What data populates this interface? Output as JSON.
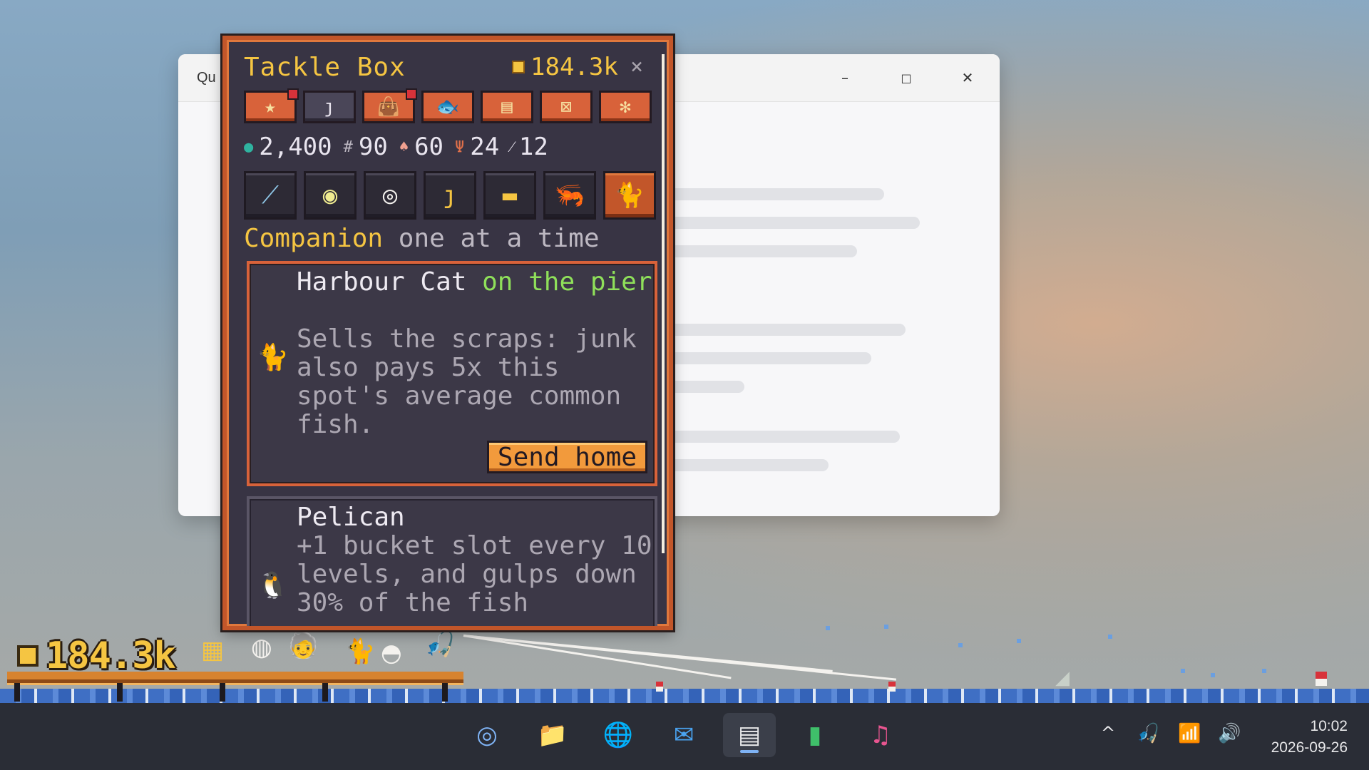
{
  "bg_window": {
    "title": "Qu",
    "minimize_glyph": "–",
    "maximize_glyph": "□",
    "close_glyph": "✕"
  },
  "tackle_box": {
    "title": "Tackle Box",
    "coins": "184.3k",
    "close_glyph": "×",
    "tabs": [
      {
        "icon": "★",
        "icon_name": "star-icon",
        "active": true,
        "notify": true
      },
      {
        "icon": "ȷ",
        "icon_name": "hook-icon",
        "active": false,
        "notify": false
      },
      {
        "icon": "👜",
        "icon_name": "bag-icon",
        "active": true,
        "notify": true
      },
      {
        "icon": "🐟",
        "icon_name": "fish-icon",
        "active": true,
        "notify": false
      },
      {
        "icon": "▤",
        "icon_name": "journal-icon",
        "active": true,
        "notify": false
      },
      {
        "icon": "⊠",
        "icon_name": "map-icon",
        "active": true,
        "notify": false
      },
      {
        "icon": "✻",
        "icon_name": "settings-icon",
        "active": true,
        "notify": false
      }
    ],
    "stats": [
      {
        "icon": "●",
        "icon_name": "gem-icon",
        "color": "#2fb3a0",
        "value": "2,400"
      },
      {
        "icon": "#",
        "icon_name": "net-icon",
        "color": "#bdb8c2",
        "value": "90"
      },
      {
        "icon": "♠",
        "icon_name": "bait-icon",
        "color": "#f0a090",
        "value": "60"
      },
      {
        "icon": "Ψ",
        "icon_name": "trophy-icon",
        "color": "#e0704a",
        "value": "24"
      },
      {
        "icon": "⁄",
        "icon_name": "rod-icon",
        "color": "#e9e5ef",
        "value": "12"
      }
    ],
    "slots": [
      {
        "icon": "⟋",
        "icon_name": "rod-slot-icon",
        "color": "#8fc7e8",
        "selected": false
      },
      {
        "icon": "◉",
        "icon_name": "bobber-slot-icon",
        "color": "#f0ec90",
        "selected": false
      },
      {
        "icon": "◎",
        "icon_name": "line-slot-icon",
        "color": "#f4f2ee",
        "selected": false
      },
      {
        "icon": "ȷ",
        "icon_name": "hook-slot-icon",
        "color": "#f5c542",
        "selected": false
      },
      {
        "icon": "▬",
        "icon_name": "hat-slot-icon",
        "color": "#f5c542",
        "selected": false
      },
      {
        "icon": "🦐",
        "icon_name": "bait-slot-icon",
        "color": "#e0704a",
        "selected": false
      },
      {
        "icon": "🐈",
        "icon_name": "companion-slot-icon",
        "color": "#e0704a",
        "selected": true
      }
    ],
    "section_title": "Companion",
    "section_sub": "one at a time",
    "companions": [
      {
        "icon": "🐈",
        "icon_name": "cat-icon",
        "name": "Harbour Cat",
        "location": "on the pier",
        "desc": "Sells the scraps: junk also pays 5x this spot's average common fish.",
        "button": "Send home"
      },
      {
        "icon": "🐧",
        "icon_name": "pelican-icon",
        "name": "Pelican",
        "desc": "+1 bucket slot every 10 levels, and gulps down 30% of the fish"
      }
    ]
  },
  "hud": {
    "coins": "184.3k"
  },
  "taskbar": {
    "apps": [
      {
        "icon": "◎",
        "icon_name": "launcher-icon",
        "color": "#7fb3f5"
      },
      {
        "icon": "📁",
        "icon_name": "folder-icon",
        "color": "#f5c542"
      },
      {
        "icon": "🌐",
        "icon_name": "browser-icon",
        "color": "#4a90e2"
      },
      {
        "icon": "✉",
        "icon_name": "mail-icon",
        "color": "#4aa3f0"
      },
      {
        "icon": "▤",
        "icon_name": "notes-icon",
        "color": "#e8e8ea",
        "active": true
      },
      {
        "icon": "▮",
        "icon_name": "chat-icon",
        "color": "#3fbf6a"
      },
      {
        "icon": "♫",
        "icon_name": "music-icon",
        "color": "#e85590"
      }
    ],
    "tray_chevron": "^",
    "tray_game": "🎣",
    "tray_wifi": "📶",
    "tray_volume": "🔊",
    "time": "10:02",
    "date": "2026-09-26"
  }
}
